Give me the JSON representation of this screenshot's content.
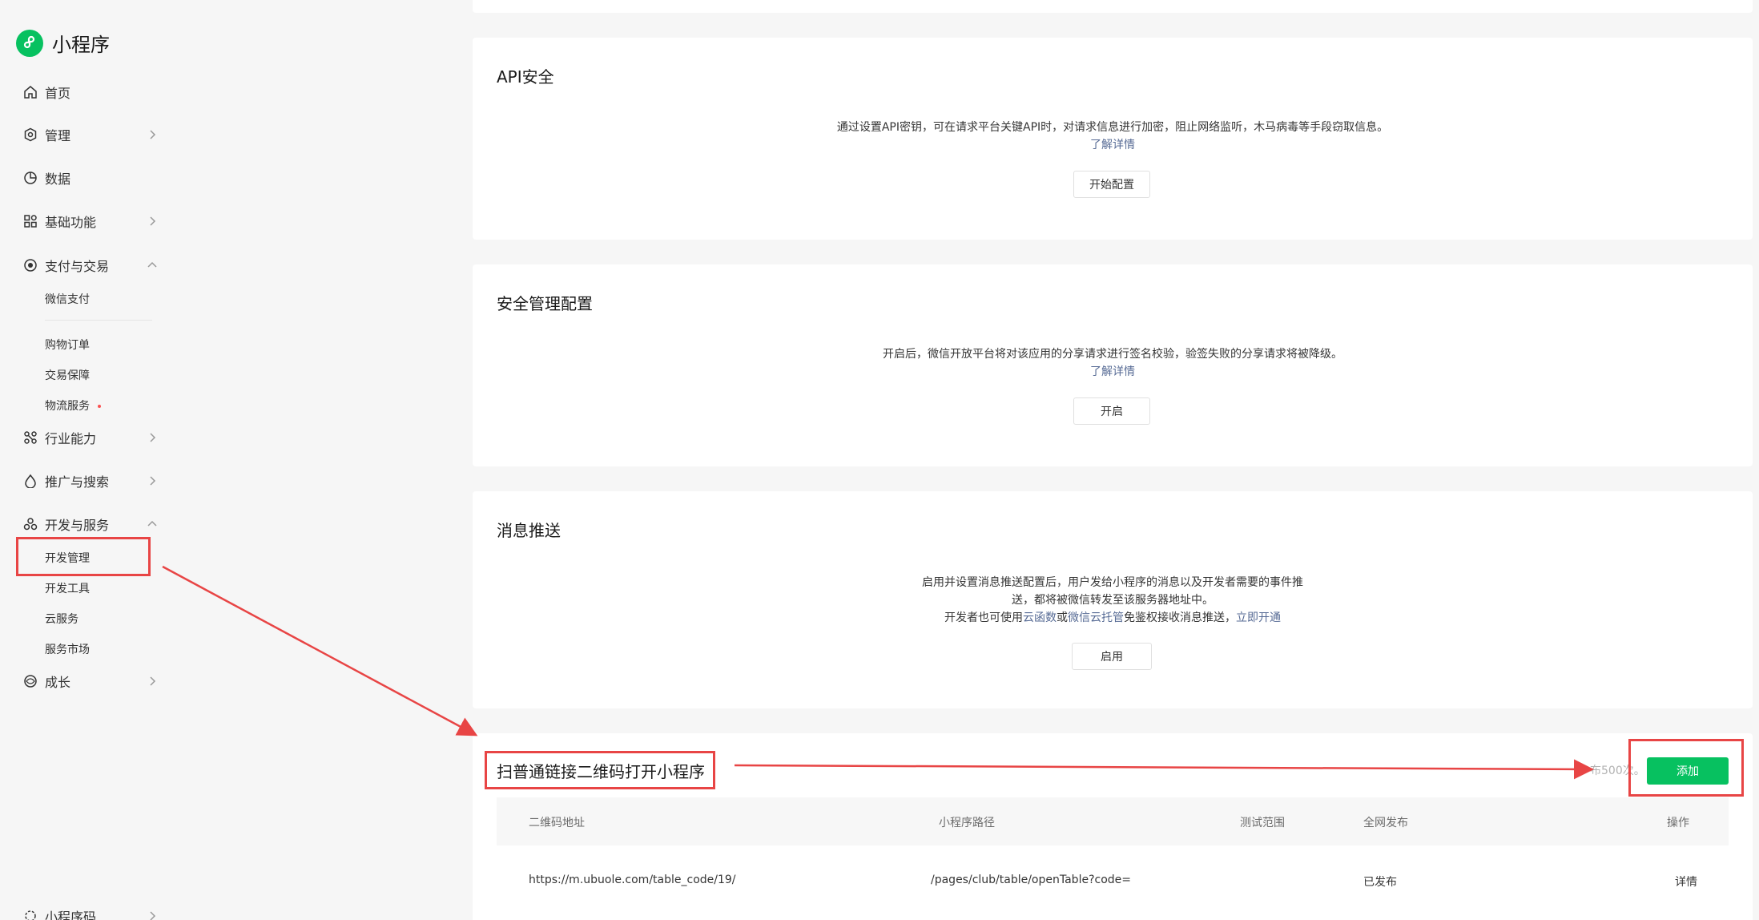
{
  "brand": {
    "name": "小程序"
  },
  "sidebar": {
    "items": [
      {
        "label": "首页",
        "icon": "home-icon"
      },
      {
        "label": "管理",
        "icon": "settings-icon"
      },
      {
        "label": "数据",
        "icon": "chart-pie-icon"
      },
      {
        "label": "基础功能",
        "icon": "grid-icon"
      },
      {
        "label": "支付与交易",
        "icon": "target-icon"
      },
      {
        "label": "行业能力",
        "icon": "nodes-icon"
      },
      {
        "label": "推广与搜索",
        "icon": "drop-icon"
      },
      {
        "label": "开发与服务",
        "icon": "cluster-icon"
      },
      {
        "label": "成长",
        "icon": "growth-icon"
      },
      {
        "label": "小程序码",
        "icon": "code-icon"
      }
    ],
    "pay_sub": [
      "微信支付",
      "购物订单",
      "交易保障",
      "物流服务"
    ],
    "dev_sub": [
      "开发管理",
      "开发工具",
      "云服务",
      "服务市场"
    ]
  },
  "api_security": {
    "title": "API安全",
    "desc": "通过设置API密钥，可在请求平台关键API时，对请求信息进行加密，阻止网络监听，木马病毒等手段窃取信息。",
    "link": "了解详情",
    "button": "开始配置"
  },
  "security_config": {
    "title": "安全管理配置",
    "desc": "开启后，微信开放平台将对该应用的分享请求进行签名校验，验签失败的分享请求将被降级。",
    "link": "了解详情",
    "button": "开启"
  },
  "message_push": {
    "title": "消息推送",
    "desc_line1": "启用并设置消息推送配置后，用户发给小程序的消息以及开发者需要的事件推",
    "desc_line2": "送，都将被微信转发至该服务器地址中。",
    "desc_line3_a": "开发者也可使用",
    "desc_line3_link1": "云函数",
    "desc_line3_b": "或",
    "desc_line3_link2": "微信云托管",
    "desc_line3_c": "免鉴权接收消息推送，",
    "desc_line3_link3": "立即开通",
    "button": "启用"
  },
  "qrcode_section": {
    "title": "扫普通链接二维码打开小程序",
    "hint": "布500次。",
    "add_button": "添加",
    "columns": [
      "二维码地址",
      "小程序路径",
      "测试范围",
      "全网发布",
      "操作"
    ],
    "rows": [
      {
        "url": "https://m.ubuole.com/table_code/19/",
        "path": "/pages/club/table/openTable?code=",
        "range": "",
        "status": "已发布",
        "action": "详情"
      }
    ]
  },
  "colors": {
    "brand": "#07c160",
    "link": "#576b95",
    "annotation": "#e84545"
  }
}
